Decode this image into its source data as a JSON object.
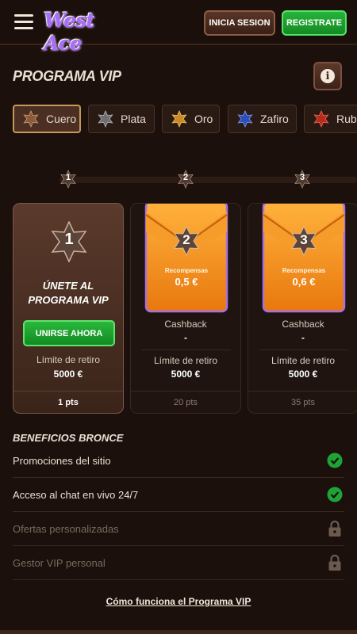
{
  "header": {
    "logo_text": "West Ace",
    "login_label": "INICIA SESION",
    "register_label": "REGISTRATE"
  },
  "page": {
    "title": "PROGRAMA VIP"
  },
  "tabs": [
    {
      "label": "Cuero",
      "color": "#8b5a3c",
      "active": true
    },
    {
      "label": "Plata",
      "color": "#6f6f73",
      "active": false
    },
    {
      "label": "Oro",
      "color": "#c98a24",
      "active": false
    },
    {
      "label": "Zafiro",
      "color": "#2c4fb8",
      "active": false
    },
    {
      "label": "Rubí",
      "color": "#b52b1c",
      "active": false
    }
  ],
  "track": {
    "nodes": [
      "1",
      "2",
      "3"
    ]
  },
  "cards": [
    {
      "level": "1",
      "join_title": "ÚNETE AL PROGRAMA VIP",
      "join_button": "UNIRSE AHORA",
      "limit_label": "Límite de retiro",
      "limit_value": "5000 €",
      "points": "1 pts"
    },
    {
      "level": "2",
      "reward_label": "Recompensas",
      "reward_value": "0,5 €",
      "cashback_label": "Cashback",
      "cashback_value": "-",
      "limit_label": "Límite de retiro",
      "limit_value": "5000 €",
      "points": "20 pts"
    },
    {
      "level": "3",
      "reward_label": "Recompensas",
      "reward_value": "0,6 €",
      "cashback_label": "Cashback",
      "cashback_value": "-",
      "limit_label": "Límite de retiro",
      "limit_value": "5000 €",
      "points": "35 pts"
    }
  ],
  "benefits": {
    "title": "BENEFICIOS BRONCE",
    "items": [
      {
        "label": "Promociones del sitio",
        "status": "unlocked"
      },
      {
        "label": "Acceso al chat en vivo 24/7",
        "status": "unlocked"
      },
      {
        "label": "Ofertas personalizadas",
        "status": "locked"
      },
      {
        "label": "Gestor VIP personal",
        "status": "locked"
      }
    ]
  },
  "footer": {
    "link_label": "Cómo funciona el Programa VIP"
  },
  "colors": {
    "accent_green": "#1fa833",
    "background": "#1c100c",
    "check_green": "#1ea436"
  }
}
